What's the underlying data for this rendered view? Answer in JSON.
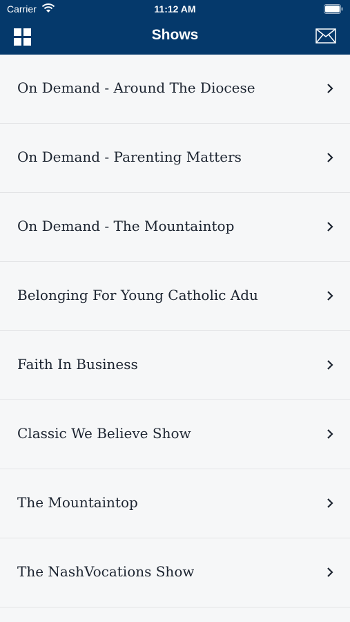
{
  "status_bar": {
    "carrier": "Carrier",
    "time": "11:12 AM"
  },
  "nav": {
    "title": "Shows",
    "left_icon": "grid-menu-icon",
    "right_icon": "mail-icon"
  },
  "colors": {
    "header_bg": "#05396b",
    "list_bg": "#f6f7f8",
    "text": "#1c2430"
  },
  "shows": [
    {
      "label": "On Demand - Around The Diocese"
    },
    {
      "label": "On Demand - Parenting Matters"
    },
    {
      "label": "On Demand - The Mountaintop"
    },
    {
      "label": "Belonging For Young Catholic Adu"
    },
    {
      "label": "Faith In Business"
    },
    {
      "label": "Classic We Believe Show"
    },
    {
      "label": "The Mountaintop"
    },
    {
      "label": "The NashVocations Show"
    }
  ]
}
